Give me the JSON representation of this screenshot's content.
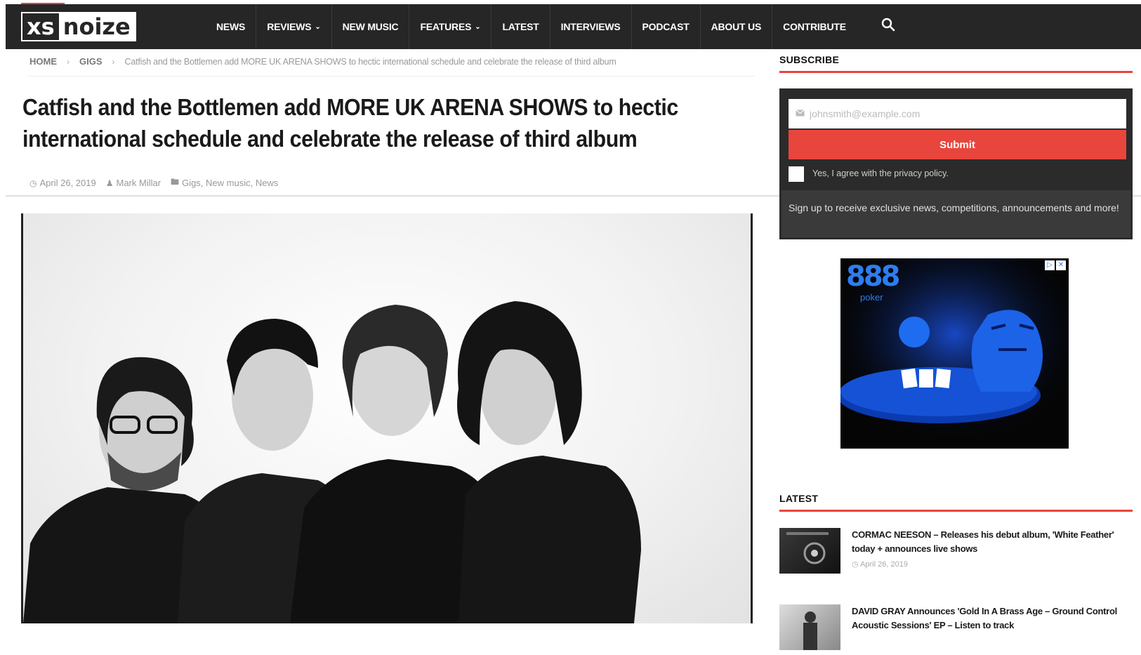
{
  "site": {
    "logo_left": "xs",
    "logo_right": "noize"
  },
  "nav": {
    "items": [
      {
        "label": "NEWS",
        "has_dropdown": false
      },
      {
        "label": "REVIEWS",
        "has_dropdown": true
      },
      {
        "label": "NEW MUSIC",
        "has_dropdown": false
      },
      {
        "label": "FEATURES",
        "has_dropdown": true
      },
      {
        "label": "LATEST",
        "has_dropdown": false
      },
      {
        "label": "INTERVIEWS",
        "has_dropdown": false
      },
      {
        "label": "PODCAST",
        "has_dropdown": false
      },
      {
        "label": "ABOUT US",
        "has_dropdown": false
      },
      {
        "label": "CONTRIBUTE",
        "has_dropdown": false
      }
    ],
    "search_icon": "search-icon"
  },
  "breadcrumb": {
    "home": "HOME",
    "section": "GIGS",
    "current": "Catfish and the Bottlemen add MORE UK ARENA SHOWS to hectic international schedule and celebrate the release of third album"
  },
  "article": {
    "title": "Catfish and the Bottlemen add MORE UK ARENA SHOWS to hectic international schedule and celebrate the release of third album",
    "date": "April 26, 2019",
    "author": "Mark Millar",
    "categories": [
      "Gigs",
      "New music",
      "News"
    ]
  },
  "sidebar": {
    "subscribe": {
      "heading": "SUBSCRIBE",
      "email_placeholder": "johnsmith@example.com",
      "submit_label": "Submit",
      "privacy_label": "Yes, I agree with the privacy policy.",
      "description": "Sign up to receive exclusive news, competitions, announcements and more!"
    },
    "ad": {
      "brand": "888",
      "brand_sub": "poker"
    },
    "latest": {
      "heading": "LATEST",
      "items": [
        {
          "title": "CORMAC NEESON – Releases his debut album, 'White Feather' today + announces live shows",
          "date": "April 26, 2019"
        },
        {
          "title": "DAVID GRAY Announces 'Gold In A Brass Age – Ground Control Acoustic Sessions' EP – Listen to track",
          "date": ""
        }
      ]
    }
  },
  "colors": {
    "nav_bg": "#262626",
    "accent": "#e8453c"
  }
}
